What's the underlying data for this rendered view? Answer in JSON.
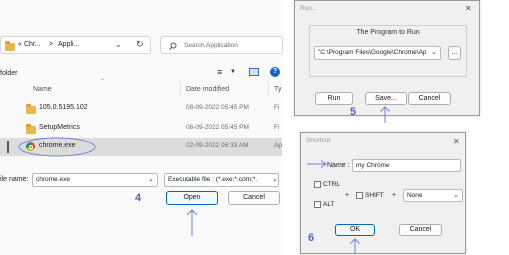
{
  "explorer": {
    "breadcrumb_prefix": "«",
    "breadcrumb_1": "Chr...",
    "breadcrumb_sep": ">",
    "breadcrumb_2": "Appli...",
    "search_placeholder": "Search Application",
    "left_label": "folder",
    "col_name": "Name",
    "col_date": "Date modified",
    "col_type": "Ty",
    "rows": [
      {
        "name": "105.0.5195.102",
        "date": "08-09-2022 05:45 PM",
        "type": "Fi"
      },
      {
        "name": "SetupMetrics",
        "date": "08-09-2022 05:45 PM",
        "type": "Fi"
      },
      {
        "name": "chrome.exe",
        "date": "02-09-2022 06:33 AM",
        "type": "Ap"
      }
    ],
    "file_name_label": "ile name:",
    "file_name_value": "chrome.exe",
    "filter_value": "Executable file : (*.exe;*.com;*.",
    "open_label": "Open",
    "cancel_label": "Cancel",
    "step_label": "4"
  },
  "run_dialog": {
    "title": "Run...",
    "group_label": "The Program to Run",
    "path_value": "\"C:\\Program Files\\Google\\Chrome\\Ap",
    "browse_label": "...",
    "run_label": "Run",
    "save_label": "Save...",
    "cancel_label": "Cancel",
    "step_label": "5"
  },
  "shortcut_dialog": {
    "title": "Shortcut",
    "name_label": "Name :",
    "name_value": "my Chrome",
    "ctrl_label": "CTRL",
    "alt_label": "ALT",
    "plus_1": "+",
    "shift_label": "SHIFT",
    "plus_2": "+",
    "key_value": "None",
    "ok_label": "OK",
    "cancel_label": "Cancel",
    "step_label": "6"
  },
  "colors": {
    "accent": "#0067c0",
    "annotation": "#4b63c7",
    "selected_row": "#dcdcdc"
  }
}
